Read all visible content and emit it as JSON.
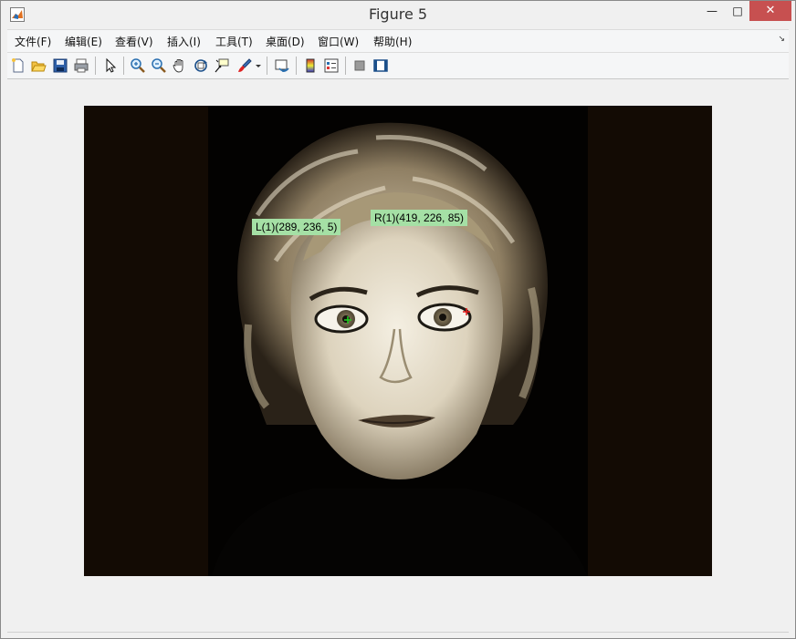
{
  "window": {
    "title": "Figure 5",
    "controls": {
      "minimize": "—",
      "maximize": "□",
      "close": "✕"
    }
  },
  "menubar": {
    "items": [
      {
        "label": "文件(F)"
      },
      {
        "label": "编辑(E)"
      },
      {
        "label": "查看(V)"
      },
      {
        "label": "插入(I)"
      },
      {
        "label": "工具(T)"
      },
      {
        "label": "桌面(D)"
      },
      {
        "label": "窗口(W)"
      },
      {
        "label": "帮助(H)"
      }
    ]
  },
  "toolbar": {
    "icons": [
      "new-figure-icon",
      "open-file-icon",
      "save-icon",
      "print-icon",
      "edit-plot-pointer-icon",
      "zoom-in-icon",
      "zoom-out-icon",
      "pan-hand-icon",
      "rotate-3d-icon",
      "data-cursor-icon",
      "brush-icon",
      "brush-dropdown-icon",
      "link-plot-icon",
      "colorbar-icon",
      "legend-icon",
      "hide-plot-tools-icon",
      "show-plot-tools-icon"
    ]
  },
  "figure": {
    "image": "grayscale-sepia-portrait-woman-face",
    "datatips": [
      {
        "label": "L(1)(289, 236, 5)",
        "marker": "green-plus"
      },
      {
        "label": "R(1)(419, 226, 85)",
        "marker": "red-plus"
      }
    ]
  },
  "colors": {
    "accent_close": "#c75050",
    "datatip_bg": "#a5e0a5",
    "axes_bg": "#120a04"
  }
}
